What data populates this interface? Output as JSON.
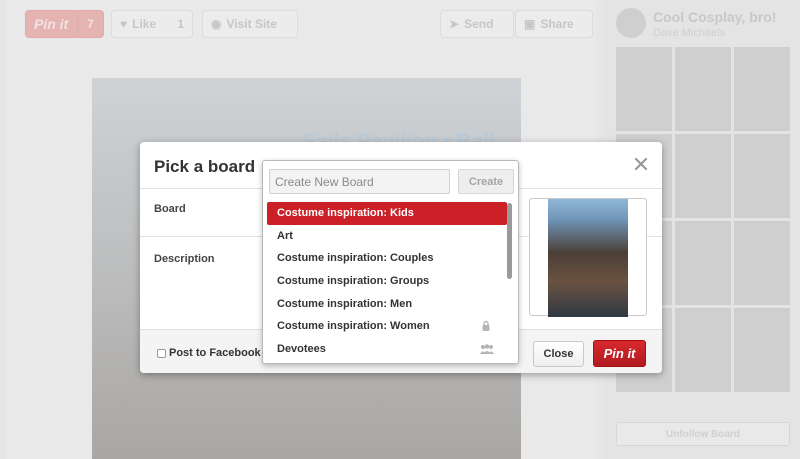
{
  "toolbar": {
    "pin_label": "Pin it",
    "pin_count": "7",
    "like_label": "Like",
    "like_count": "1",
    "visit_label": "Visit Site",
    "send_label": "Send",
    "share_label": "Share"
  },
  "photo": {
    "sign_text": "Sails Pavilion • Ball"
  },
  "board_panel": {
    "title": "Cool Cosplay, bro!",
    "owner": "Dave Michaels",
    "unfollow_label": "Unfollow Board"
  },
  "modal": {
    "title": "Pick a board",
    "board_label": "Board",
    "description_label": "Description",
    "post_to_facebook_label": "Post to Facebook",
    "close_label": "Close",
    "pin_label": "Pin it"
  },
  "dropdown": {
    "new_board_placeholder": "Create New Board",
    "create_label": "Create",
    "boards": [
      {
        "label": "Costume inspiration: Kids",
        "selected": true,
        "tag": ""
      },
      {
        "label": "Art",
        "selected": false,
        "tag": ""
      },
      {
        "label": "Costume inspiration: Couples",
        "selected": false,
        "tag": ""
      },
      {
        "label": "Costume inspiration: Groups",
        "selected": false,
        "tag": ""
      },
      {
        "label": "Costume inspiration: Men",
        "selected": false,
        "tag": ""
      },
      {
        "label": "Costume inspiration: Women",
        "selected": false,
        "tag": "lock-icon"
      },
      {
        "label": "Devotees",
        "selected": false,
        "tag": "group-icon"
      }
    ]
  },
  "colors": {
    "pinterest_red": "#cb2027",
    "overlay_gray": "#e6e6e6"
  }
}
